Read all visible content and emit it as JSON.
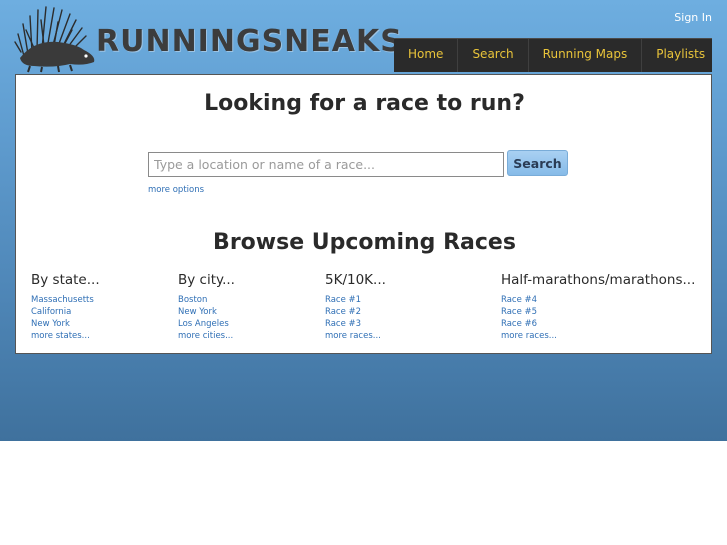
{
  "header": {
    "logo_text": "RUNNINGSNEAKS",
    "signin_label": "Sign In",
    "nav": [
      "Home",
      "Search",
      "Running Maps",
      "Playlists"
    ]
  },
  "search": {
    "title": "Looking for a race to run?",
    "placeholder": "Type a location or name of a race...",
    "button_label": "Search",
    "more_options": "more options"
  },
  "browse": {
    "title": "Browse Upcoming Races",
    "columns": [
      {
        "heading": "By state...",
        "links": [
          "Massachusetts",
          "California",
          "New York",
          "more states..."
        ]
      },
      {
        "heading": "By city...",
        "links": [
          "Boston",
          "New York",
          "Los Angeles",
          "more cities..."
        ]
      },
      {
        "heading": "5K/10K...",
        "links": [
          "Race #1",
          "Race #2",
          "Race #3",
          "more races..."
        ]
      },
      {
        "heading": "Half-marathons/marathons...",
        "links": [
          "Race #4",
          "Race #5",
          "Race #6",
          "more races..."
        ]
      }
    ]
  },
  "colors": {
    "nav_bg": "#2a2a2a",
    "nav_text": "#e9c43a",
    "link": "#2f6fb5",
    "header_gradient_top": "#6eaee0",
    "header_gradient_bottom": "#3f719d",
    "button": "#86bbe8"
  }
}
